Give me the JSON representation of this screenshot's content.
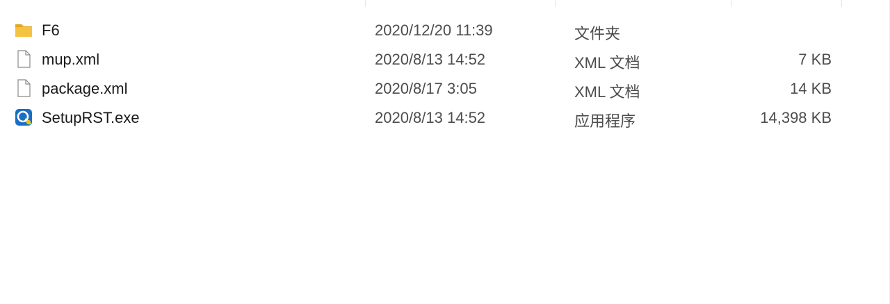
{
  "files": [
    {
      "name": "F6",
      "modified": "2020/12/20 11:39",
      "type": "文件夹",
      "size": "",
      "icon": "folder-icon"
    },
    {
      "name": "mup.xml",
      "modified": "2020/8/13 14:52",
      "type": "XML 文档",
      "size": "7 KB",
      "icon": "document-icon"
    },
    {
      "name": "package.xml",
      "modified": "2020/8/17 3:05",
      "type": "XML 文档",
      "size": "14 KB",
      "icon": "document-icon"
    },
    {
      "name": "SetupRST.exe",
      "modified": "2020/8/13 14:52",
      "type": "应用程序",
      "size": "14,398 KB",
      "icon": "application-icon"
    }
  ],
  "colors": {
    "folder": "#f5c242",
    "folder_dark": "#e3a81c",
    "app_blue": "#1a6fc4",
    "app_yellow": "#f3c400"
  }
}
